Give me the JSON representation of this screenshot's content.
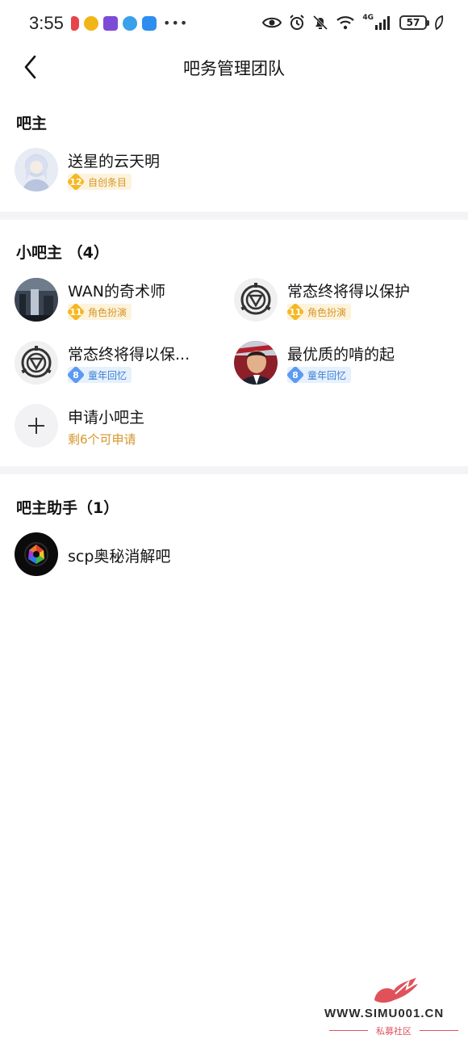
{
  "status_bar": {
    "time": "3:55",
    "network": "4G",
    "battery": "57"
  },
  "header": {
    "title": "吧务管理团队"
  },
  "owner_section": {
    "title": "吧主",
    "user": {
      "name": "送星的云天明",
      "level": "12",
      "tag": "自创条目",
      "badge_color": "#f5b824"
    }
  },
  "moderators_section": {
    "title": "小吧主 （4）",
    "users": [
      {
        "name": "WAN的奇术师",
        "level": "11",
        "tag": "角色扮演",
        "badge_color": "#f5b824"
      },
      {
        "name": "常态终将得以保护",
        "level": "11",
        "tag": "角色扮演",
        "badge_color": "#f5b824"
      },
      {
        "name": "常态终将得以保...",
        "level": "8",
        "tag": "童年回忆",
        "badge_color": "#5a9af2"
      },
      {
        "name": "最优质的啃的起",
        "level": "8",
        "tag": "童年回忆",
        "badge_color": "#5a9af2"
      }
    ],
    "apply": {
      "label": "申请小吧主",
      "remaining": "剩6个可申请"
    }
  },
  "assistants_section": {
    "title": "吧主助手（1）",
    "users": [
      {
        "name": "scp奥秘消解吧"
      }
    ]
  },
  "watermark": {
    "text": "WWW.SIMU001.CN",
    "sub": "私募社区"
  }
}
